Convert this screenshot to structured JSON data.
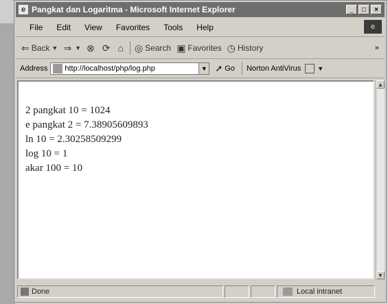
{
  "window": {
    "title": "Pangkat dan Logaritma - Microsoft Internet Explorer",
    "icon": "ie-page-icon",
    "controls": [
      "minimize",
      "maximize",
      "close"
    ]
  },
  "menubar": {
    "items": [
      "File",
      "Edit",
      "View",
      "Favorites",
      "Tools",
      "Help"
    ]
  },
  "toolbar": {
    "back_label": "Back",
    "forward_label": "⇒",
    "search_label": "Search",
    "favorites_label": "Favorites",
    "history_label": "History",
    "more_label": "»"
  },
  "addressbar": {
    "label": "Address",
    "url": "http://localhost/php/log.php",
    "go_label": "Go",
    "norton_label": "Norton AntiVirus"
  },
  "content": {
    "lines": [
      "2 pangkat 10 = 1024",
      "e pangkat 2 = 7.38905609893",
      "ln 10 = 2.30258509299",
      "log 10 = 1",
      "akar 100 = 10"
    ]
  },
  "statusbar": {
    "status_text": "Done",
    "zone_text": "Local intranet"
  },
  "colors": {
    "window_bg": "#d4d0c8",
    "titlebar": "#6e6e6e",
    "content_bg": "#ffffff"
  }
}
